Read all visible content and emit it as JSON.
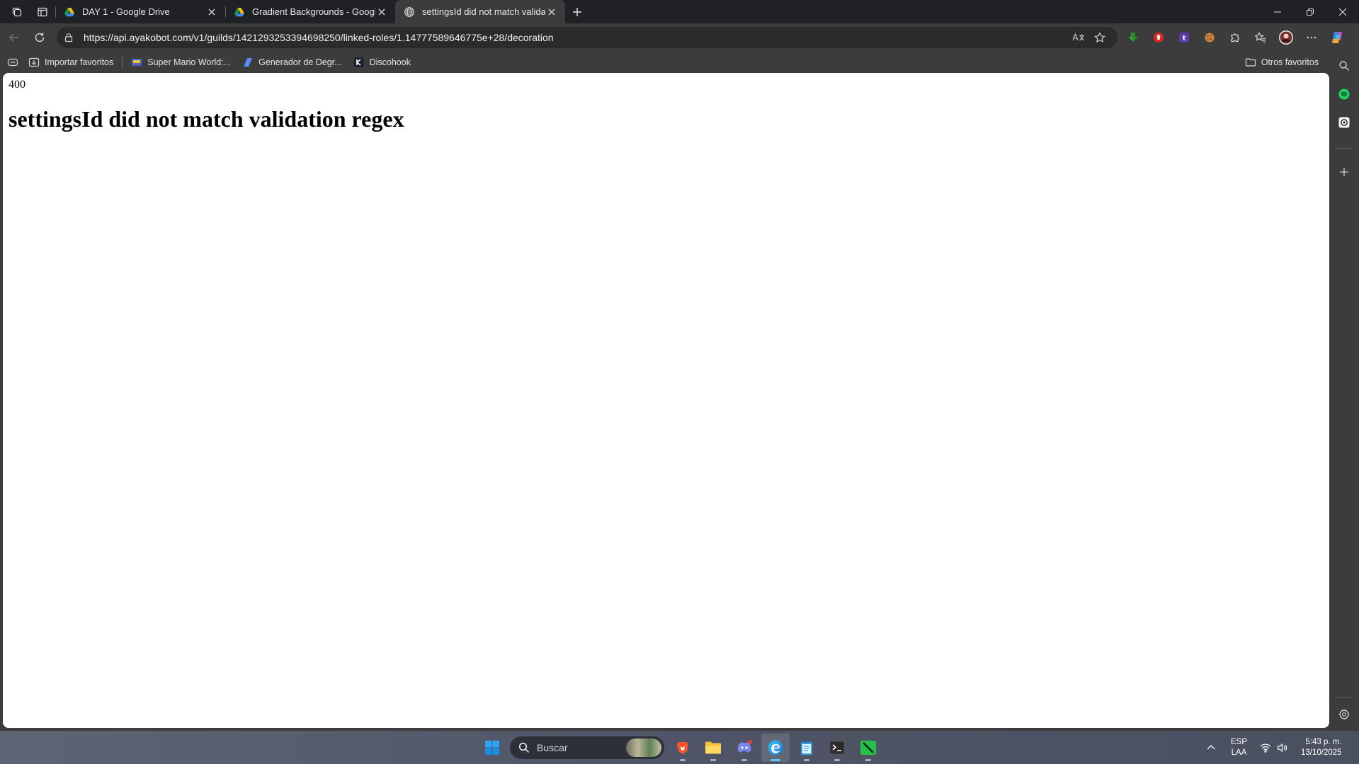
{
  "tabs": [
    {
      "title": "DAY 1 - Google Drive",
      "favicon": "google-drive-icon",
      "active": false
    },
    {
      "title": "Gradient Backgrounds - Google D",
      "favicon": "google-drive-icon",
      "active": false
    },
    {
      "title": "settingsId did not match validatio",
      "favicon": "globe-icon",
      "active": true
    }
  ],
  "address_bar": {
    "url": "https://api.ayakobot.com/v1/guilds/1421293253394698250/linked-roles/1.14777589646775e+28/decoration"
  },
  "bookmarks": [
    {
      "label": "Importar favoritos",
      "icon": "import-favorites-icon"
    },
    {
      "label": "Super Mario World:...",
      "icon": "mario-icon"
    },
    {
      "label": "Generador de Degr...",
      "icon": "gradient-generator-icon"
    },
    {
      "label": "Discohook",
      "icon": "discohook-icon"
    }
  ],
  "other_favorites": "Otros favoritos",
  "page": {
    "status_code": "400",
    "message": "settingsId did not match validation regex"
  },
  "taskbar": {
    "search_placeholder": "Buscar",
    "language": "ESP",
    "keyboard": "LAA",
    "time": "5:43 p. m.",
    "date": "13/10/2025"
  },
  "colors": {
    "tab_strip": "#202124",
    "toolbar": "#3c3c3c",
    "page_bg": "#ffffff",
    "active_tab_indicator": "#5cc6ff"
  }
}
